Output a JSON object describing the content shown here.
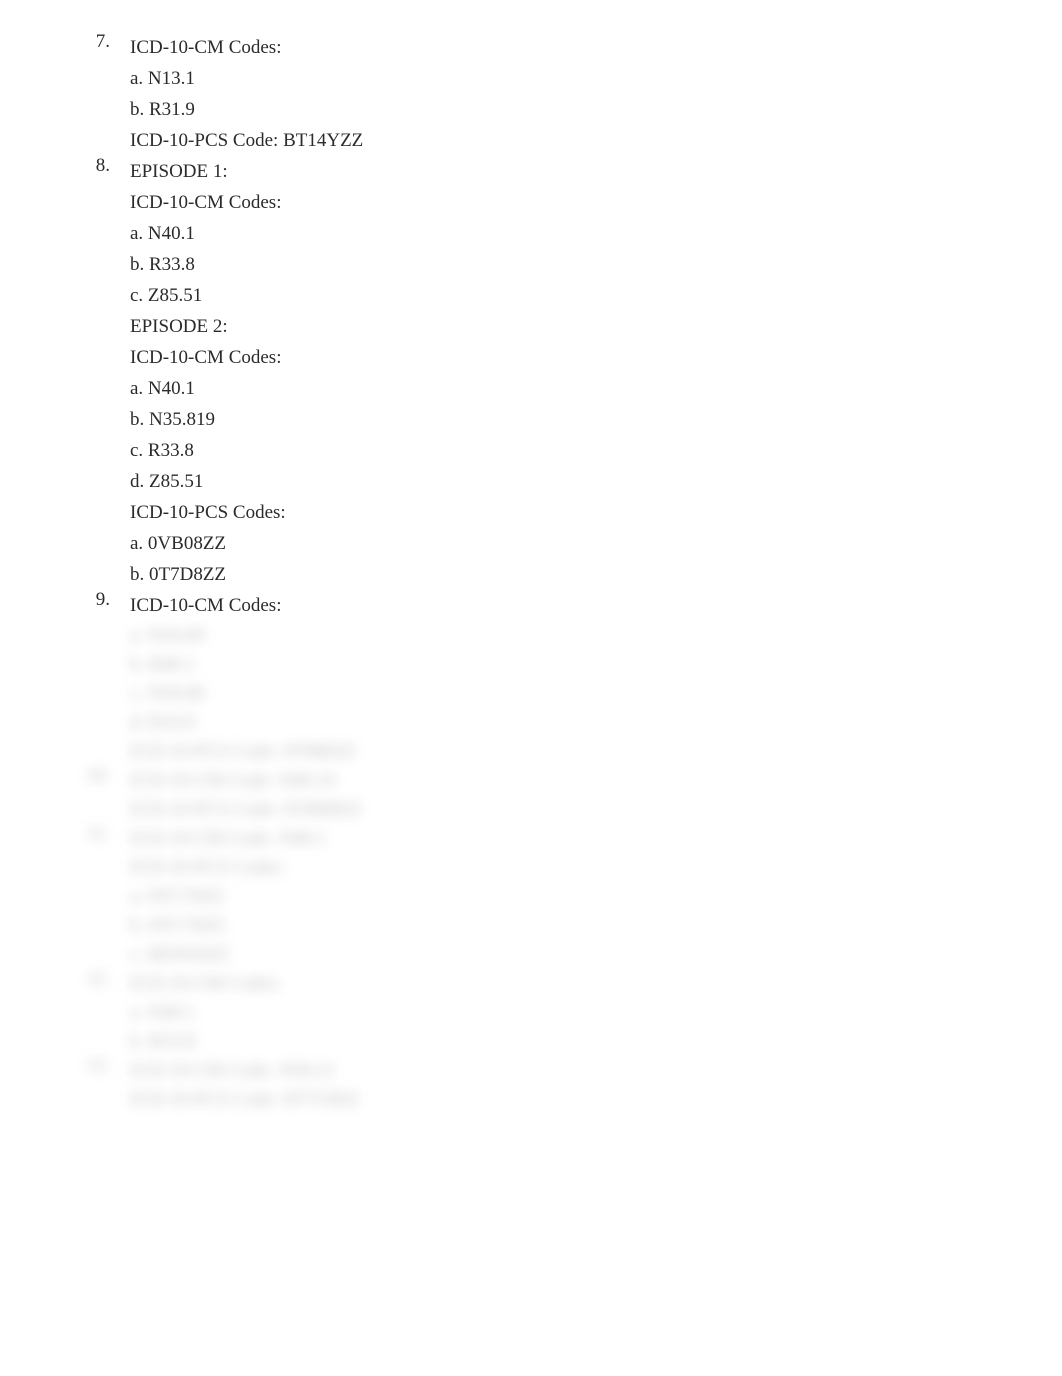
{
  "items": [
    {
      "marker": "7.",
      "lines": [
        "ICD-10-CM Codes:",
        "a. N13.1",
        "b. R31.9",
        "ICD-10-PCS Code: BT14YZZ"
      ]
    },
    {
      "marker": "8.",
      "lines": [
        "EPISODE 1:",
        "ICD-10-CM Codes:",
        "a. N40.1",
        "b. R33.8",
        "c. Z85.51",
        "EPISODE 2:",
        "ICD-10-CM Codes:",
        "a. N40.1",
        "b. N35.819",
        "c. R33.8",
        "d. Z85.51",
        "ICD-10-PCS Codes:",
        "a. 0VB08ZZ",
        "b. 0T7D8ZZ"
      ]
    },
    {
      "marker": "9.",
      "lines": [
        "ICD-10-CM Codes:"
      ]
    }
  ],
  "blurred_items": [
    {
      "marker": "",
      "lines": [
        "a. N20.00",
        "b. R40.1",
        "c. N39.00",
        "d. R10.9",
        "ICD-10-PCS Code: 0T980ZZ"
      ]
    },
    {
      "marker": "10.",
      "lines": [
        "ICD-10-CM Code: N40.10",
        "ICD-10-PCS Code: 0VB08ZZ"
      ]
    },
    {
      "marker": "11.",
      "lines": [
        "ICD-10-CM Code: N40.1",
        "ICD-10-PCS Codes:",
        "a. 0TC70ZZ",
        "b. 0TC70ZZ",
        "c. 8E0W0ZZ"
      ]
    },
    {
      "marker": "12.",
      "lines": [
        "ICD-10-CM Codes:",
        "a. N40.1",
        "b. R33.8"
      ]
    },
    {
      "marker": "13.",
      "lines": [
        "ICD-10-CM Code: N30.21",
        "ICD-10-PCS Code: 0T7C8ZZ"
      ]
    }
  ]
}
